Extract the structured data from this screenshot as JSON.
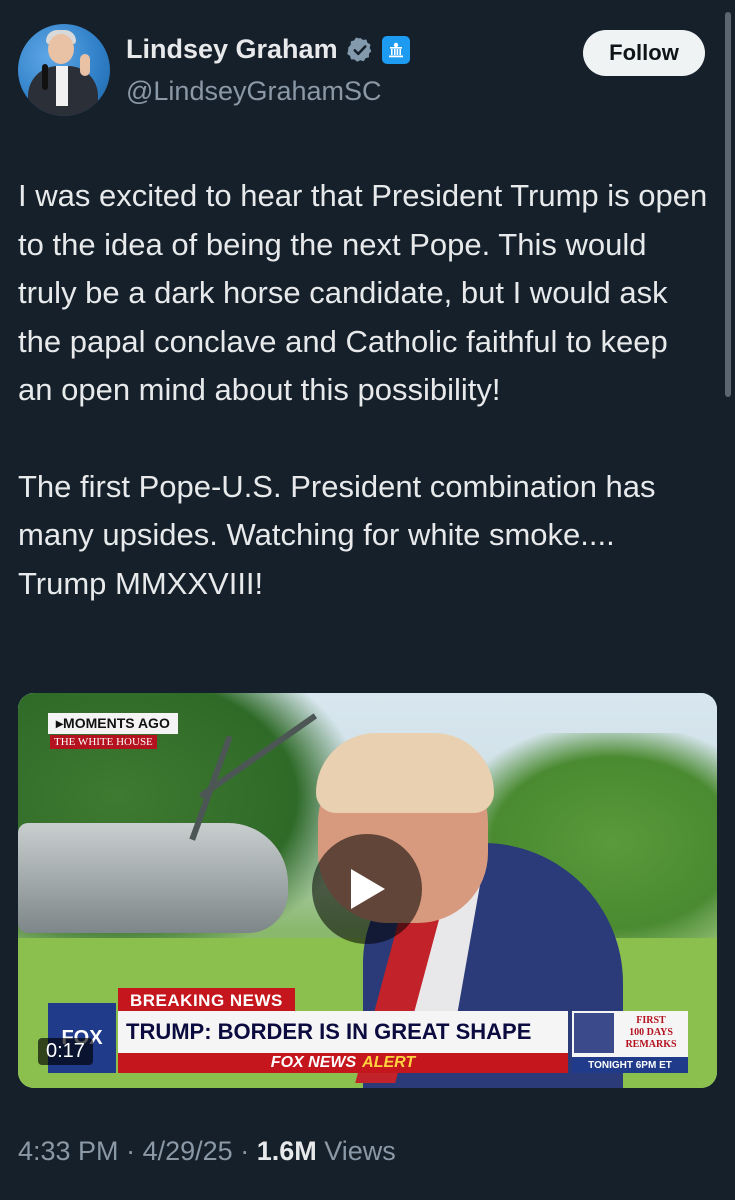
{
  "author": {
    "name": "Lindsey Graham",
    "handle": "@LindseyGrahamSC",
    "verified_icon": "verified-badge-icon",
    "affiliation_icon": "government-building-icon"
  },
  "follow_label": "Follow",
  "tweet": {
    "paragraph1": "I was excited to hear that President Trump is open to the idea of being the next Pope. This would truly be a dark horse candidate, but I would ask the papal conclave and Catholic faithful to keep an open mind about this possibility!",
    "paragraph2": "The first Pope-U.S. President combination has many upsides. Watching for white smoke.... Trump MMXXVIII!"
  },
  "media": {
    "duration": "0:17",
    "chyron_top": "▸MOMENTS AGO",
    "chyron_location": "THE WHITE HOUSE",
    "breaking_label": "BREAKING NEWS",
    "headline": "TRUMP: BORDER IS IN GREAT SHAPE",
    "alert_brand": "FOX NEWS",
    "alert_word": "ALERT",
    "logo_text": "FOX",
    "promo_line1": "FIRST",
    "promo_line2": "100 DAYS",
    "promo_line3": "REMARKS",
    "promo_time": "TONIGHT 6PM ET"
  },
  "meta": {
    "time": "4:33 PM",
    "date": "4/29/25",
    "views_count": "1.6M",
    "views_label": "Views"
  },
  "colors": {
    "background": "#15202b",
    "text": "#e7e9ea",
    "muted": "#8b98a5",
    "accent": "#1d9bf0",
    "follow_bg": "#eff3f4"
  }
}
